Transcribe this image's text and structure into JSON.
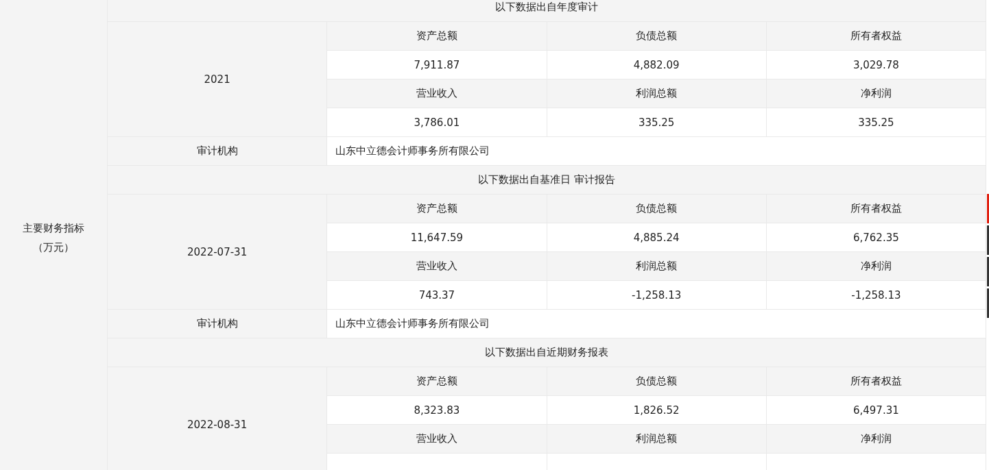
{
  "indicator": {
    "title": "主要财务指标",
    "unit": "（万元）"
  },
  "sections": [
    {
      "heading": "以下数据出自年度审计",
      "period": "2021",
      "rows": [
        {
          "kind": "labels",
          "cells": [
            "资产总额",
            "负债总额",
            "所有者权益"
          ]
        },
        {
          "kind": "values",
          "cells": [
            "7,911.87",
            "4,882.09",
            "3,029.78"
          ]
        },
        {
          "kind": "labels",
          "cells": [
            "营业收入",
            "利润总额",
            "净利润"
          ]
        },
        {
          "kind": "values",
          "cells": [
            "3,786.01",
            "335.25",
            "335.25"
          ]
        }
      ],
      "auditor": {
        "label": "审计机构",
        "name": "山东中立德会计师事务所有限公司"
      }
    },
    {
      "heading": "以下数据出自基准日 审计报告",
      "period": "2022-07-31",
      "rows": [
        {
          "kind": "labels",
          "cells": [
            "资产总额",
            "负债总额",
            "所有者权益"
          ]
        },
        {
          "kind": "values",
          "cells": [
            "11,647.59",
            "4,885.24",
            "6,762.35"
          ]
        },
        {
          "kind": "labels",
          "cells": [
            "营业收入",
            "利润总额",
            "净利润"
          ]
        },
        {
          "kind": "values",
          "cells": [
            "743.37",
            "-1,258.13",
            "-1,258.13"
          ]
        }
      ],
      "auditor": {
        "label": "审计机构",
        "name": "山东中立德会计师事务所有限公司"
      }
    },
    {
      "heading": "以下数据出自近期财务报表",
      "period": "2022-08-31",
      "rows": [
        {
          "kind": "labels",
          "cells": [
            "资产总额",
            "负债总额",
            "所有者权益"
          ]
        },
        {
          "kind": "values",
          "cells": [
            "8,323.83",
            "1,826.52",
            "6,497.31"
          ]
        },
        {
          "kind": "labels",
          "cells": [
            "营业收入",
            "利润总额",
            "净利润"
          ]
        }
      ]
    }
  ]
}
